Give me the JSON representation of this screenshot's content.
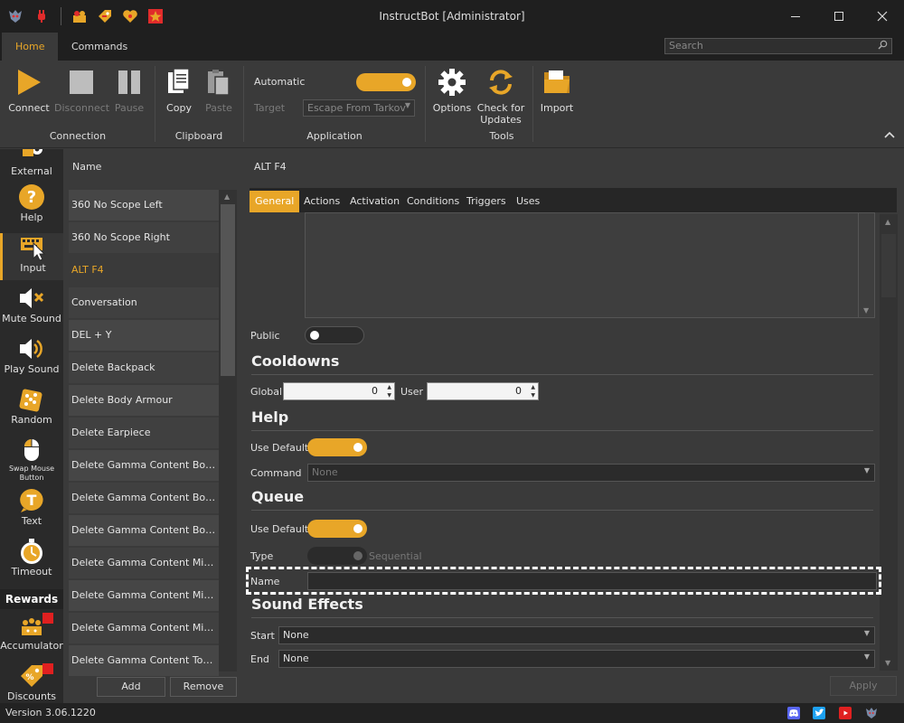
{
  "window": {
    "title": "InstructBot [Administrator]"
  },
  "menu_tabs": [
    "Home",
    "Commands"
  ],
  "search": {
    "placeholder": "Search"
  },
  "ribbon": {
    "connect": "Connect",
    "disconnect": "Disconnect",
    "pause": "Pause",
    "copy": "Copy",
    "paste": "Paste",
    "automatic_label": "Automatic",
    "target_label": "Target",
    "target_value": "Escape From Tarkov",
    "options": "Options",
    "check_updates_l1": "Check for",
    "check_updates_l2": "Updates",
    "import": "Import",
    "groups": {
      "connection": "Connection",
      "clipboard": "Clipboard",
      "application": "Application",
      "tools": "Tools"
    },
    "automatic_on": true
  },
  "nav": {
    "external": "External",
    "help": "Help",
    "input": "Input",
    "mute_sound": "Mute Sound",
    "play_sound": "Play Sound",
    "random": "Random",
    "swap_mouse_l1": "Swap Mouse",
    "swap_mouse_l2": "Button",
    "text": "Text",
    "timeout": "Timeout",
    "rewards_header": "Rewards",
    "accumulator": "Accumulator",
    "discounts": "Discounts"
  },
  "list": {
    "header": "Name",
    "items": [
      "360 No Scope Left",
      "360 No Scope Right",
      "ALT F4",
      "Conversation",
      "DEL + Y",
      "Delete Backpack",
      "Delete Body Armour",
      "Delete Earpiece",
      "Delete Gamma Content Bottom ...",
      "Delete Gamma Content Bottom ...",
      "Delete Gamma Content Bottom ...",
      "Delete Gamma Content Middle ...",
      "Delete Gamma Content Middle L...",
      "Delete Gamma Content Middle ...",
      "Delete Gamma Content Top Ce..."
    ],
    "selected_index": 2,
    "add_button": "Add",
    "remove_button": "Remove"
  },
  "detail": {
    "title": "ALT F4",
    "tabs": [
      "General",
      "Actions",
      "Activation",
      "Conditions",
      "Triggers",
      "Uses"
    ],
    "active_tab": "General",
    "public_label": "Public",
    "public_on": false,
    "cooldowns": {
      "title": "Cooldowns",
      "global_label": "Global",
      "global_value": "0",
      "user_label": "User",
      "user_value": "0"
    },
    "help": {
      "title": "Help",
      "use_default_label": "Use Default",
      "use_default_on": true,
      "command_label": "Command",
      "command_value": "None"
    },
    "queue": {
      "title": "Queue",
      "use_default_label": "Use Default",
      "use_default_on": true,
      "type_label": "Type",
      "type_value": "Sequential",
      "name_label": "Name",
      "name_value": ""
    },
    "sound_effects": {
      "title": "Sound Effects",
      "start_label": "Start",
      "start_value": "None",
      "end_label": "End",
      "end_value": "None"
    },
    "apply_button": "Apply"
  },
  "status": {
    "version": "Version 3.06.1220"
  },
  "colors": {
    "accent": "#e8a628",
    "title_bg": "#1f1f1f",
    "panel_bg": "#3a3a3a"
  }
}
